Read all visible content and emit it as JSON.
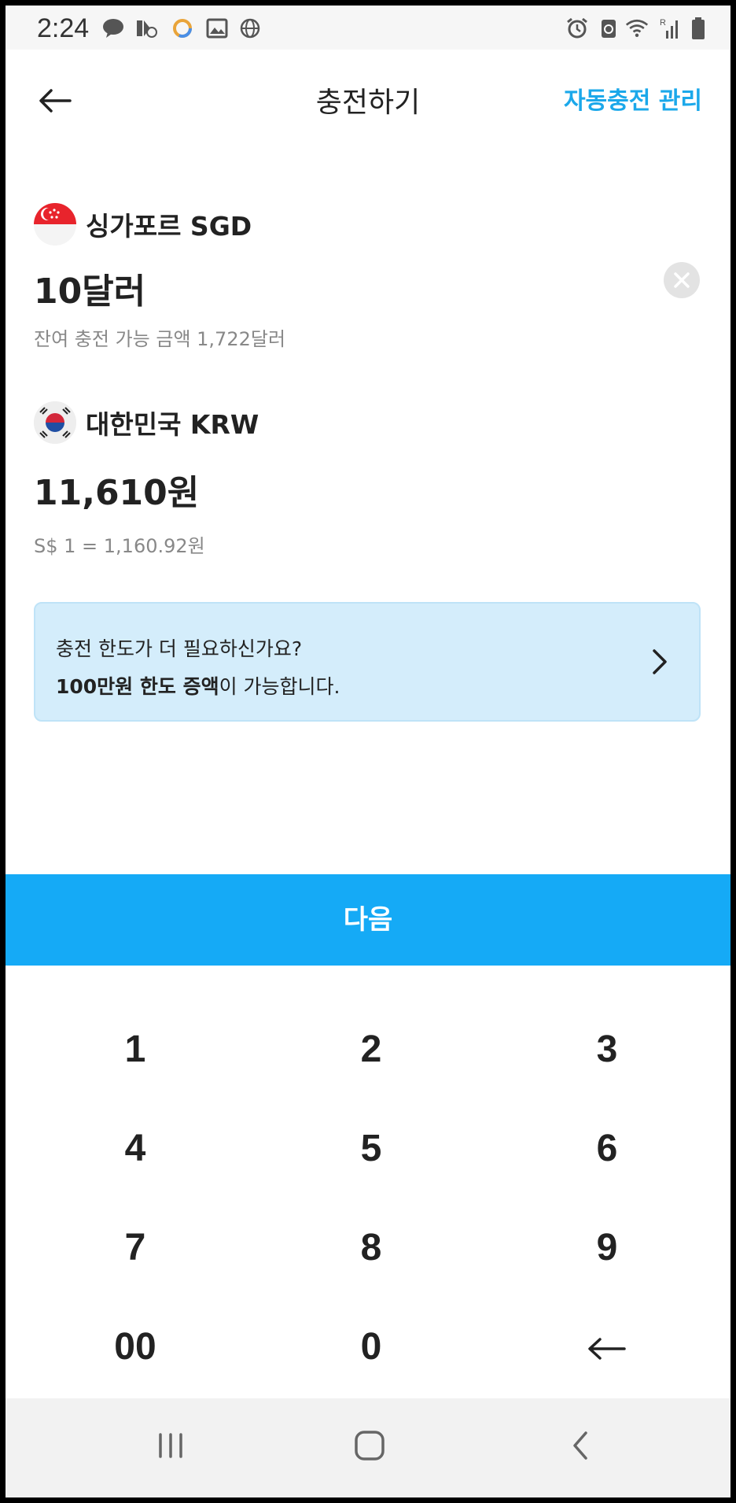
{
  "status_bar": {
    "time": "2:24",
    "left_icons": [
      "kakaotalk-icon",
      "notification-icon",
      "app-icon",
      "gallery-icon",
      "globe-icon"
    ],
    "right_icons": [
      "alarm-icon",
      "recycle-icon",
      "wifi-icon",
      "signal-icon",
      "battery-icon"
    ]
  },
  "header": {
    "title": "충전하기",
    "auto_charge_link": "자동충전 관리"
  },
  "source_currency": {
    "flag": "singapore-flag-icon",
    "name": "싱가포르 SGD",
    "amount": "10달러",
    "remaining_text": "잔여 충전 가능 금액 1,722달러"
  },
  "target_currency": {
    "flag": "korea-flag-icon",
    "name": "대한민국 KRW",
    "amount": "11,610원",
    "rate_text": "S$ 1 = 1,160.92원"
  },
  "banner": {
    "line1": "충전 한도가 더 필요하신가요?",
    "line2_bold": "100만원 한도 증액",
    "line2_rest": "이 가능합니다."
  },
  "next_button": "다음",
  "keypad": {
    "keys": [
      "1",
      "2",
      "3",
      "4",
      "5",
      "6",
      "7",
      "8",
      "9",
      "00",
      "0"
    ],
    "backspace_icon": "backspace-arrow-icon"
  },
  "colors": {
    "accent": "#15aaf6",
    "link": "#1ba8ea",
    "banner_bg": "#d4edfb"
  }
}
